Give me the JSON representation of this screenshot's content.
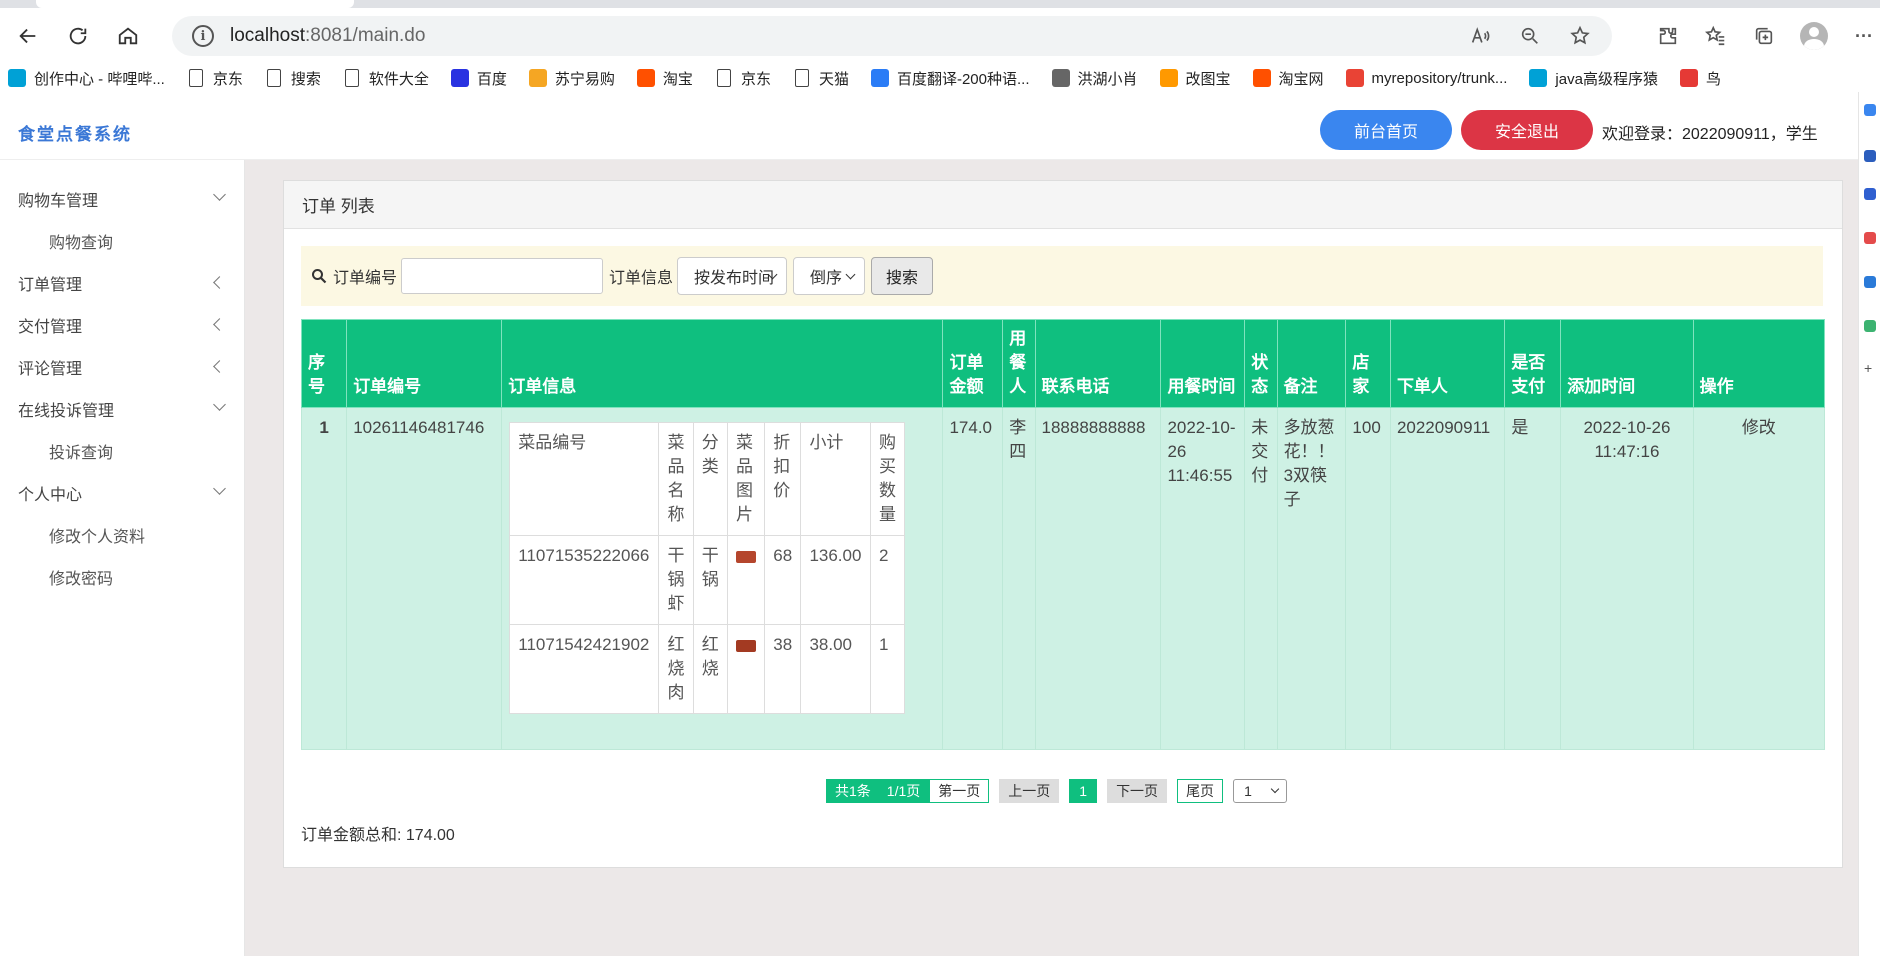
{
  "browser": {
    "url_host": "localhost",
    "url_path": ":8081/main.do",
    "bookmarks": [
      {
        "label": "创作中心 - 哔哩哔...",
        "icon": "bilibili-icon",
        "color": "#00a1d6"
      },
      {
        "label": "京东",
        "icon": "page-icon",
        "color": "#444444"
      },
      {
        "label": "搜索",
        "icon": "page-icon",
        "color": "#444444"
      },
      {
        "label": "软件大全",
        "icon": "page-icon",
        "color": "#444444"
      },
      {
        "label": "百度",
        "icon": "baidu-icon",
        "color": "#2932e1"
      },
      {
        "label": "苏宁易购",
        "icon": "suning-icon",
        "color": "#f5a623"
      },
      {
        "label": "淘宝",
        "icon": "taobao-icon",
        "color": "#ff5000"
      },
      {
        "label": "京东",
        "icon": "page-icon",
        "color": "#444444"
      },
      {
        "label": "天猫",
        "icon": "page-icon",
        "color": "#444444"
      },
      {
        "label": "百度翻译-200种语...",
        "icon": "baidu-translate-icon",
        "color": "#2a7cf6"
      },
      {
        "label": "洪湖小肖",
        "icon": "bird-icon",
        "color": "#666666"
      },
      {
        "label": "改图宝",
        "icon": "gaitubao-icon",
        "color": "#ff9900"
      },
      {
        "label": "淘宝网",
        "icon": "taobao-icon",
        "color": "#ff5000"
      },
      {
        "label": "myrepository/trunk...",
        "icon": "repo-icon",
        "color": "#e94335"
      },
      {
        "label": "java高级程序猿",
        "icon": "bilibili-icon",
        "color": "#00a1d6"
      },
      {
        "label": "鸟",
        "icon": "bird-red-icon",
        "color": "#e53935"
      }
    ]
  },
  "app": {
    "title": "食堂点餐系统",
    "home_button": "前台首页",
    "logout_button": "安全退出",
    "welcome": "欢迎登录：2022090911，学生",
    "colors": {
      "primary": "#3a86ef",
      "danger": "#dc3545",
      "table_header": "#0fbf7f",
      "table_row": "#cef1e4"
    }
  },
  "sidebar": {
    "groups": [
      {
        "label": "购物车管理",
        "expanded": true,
        "children": [
          "购物查询"
        ]
      },
      {
        "label": "订单管理",
        "expanded": false,
        "children": []
      },
      {
        "label": "交付管理",
        "expanded": false,
        "children": []
      },
      {
        "label": "评论管理",
        "expanded": false,
        "children": []
      },
      {
        "label": "在线投诉管理",
        "expanded": true,
        "children": [
          "投诉查询"
        ]
      },
      {
        "label": "个人中心",
        "expanded": true,
        "children": [
          "修改个人资料",
          "修改密码"
        ]
      }
    ]
  },
  "panel": {
    "title": "订单 列表",
    "search": {
      "order_no_label": "订单编号",
      "order_no_value": "",
      "order_info_label": "订单信息",
      "sort_field": "按发布时间",
      "sort_order": "倒序",
      "search_button": "搜索"
    },
    "table": {
      "headers": [
        "序号",
        "订单编号",
        "订单信息",
        "订单金额",
        "用餐人",
        "联系电话",
        "用餐时间",
        "状态",
        "备注",
        "店家",
        "下单人",
        "是否支付",
        "添加时间",
        "操作"
      ],
      "rows": [
        {
          "index": "1",
          "order_no": "10261146481746",
          "amount": "174.0",
          "diner": "李四",
          "phone": "18888888888",
          "meal_time": "2022-10-26 11:46:55",
          "status": "未交付",
          "remark": "多放葱花！！3双筷子",
          "shop": "100",
          "orderer": "2022090911",
          "paid": "是",
          "added": "2022-10-26 11:47:16",
          "action": "修改",
          "items_headers": [
            "菜品编号",
            "菜品名称",
            "分类",
            "菜品图片",
            "折扣价",
            "小计",
            "购买数量"
          ],
          "items": [
            {
              "code": "11071535222066",
              "name": "干锅虾",
              "category": "干锅",
              "img_color": "#b5462d",
              "price": "68",
              "subtotal": "136.00",
              "qty": "2"
            },
            {
              "code": "11071542421902",
              "name": "红烧肉",
              "category": "红烧",
              "img_color": "#a33a22",
              "price": "38",
              "subtotal": "38.00",
              "qty": "1"
            }
          ]
        }
      ]
    },
    "pager": {
      "total": "共1条",
      "pages": "1/1页",
      "first": "第一页",
      "prev": "上一页",
      "current": "1",
      "next": "下一页",
      "last": "尾页",
      "select_value": "1"
    },
    "sum_text": "订单金额总和: 174.00"
  }
}
